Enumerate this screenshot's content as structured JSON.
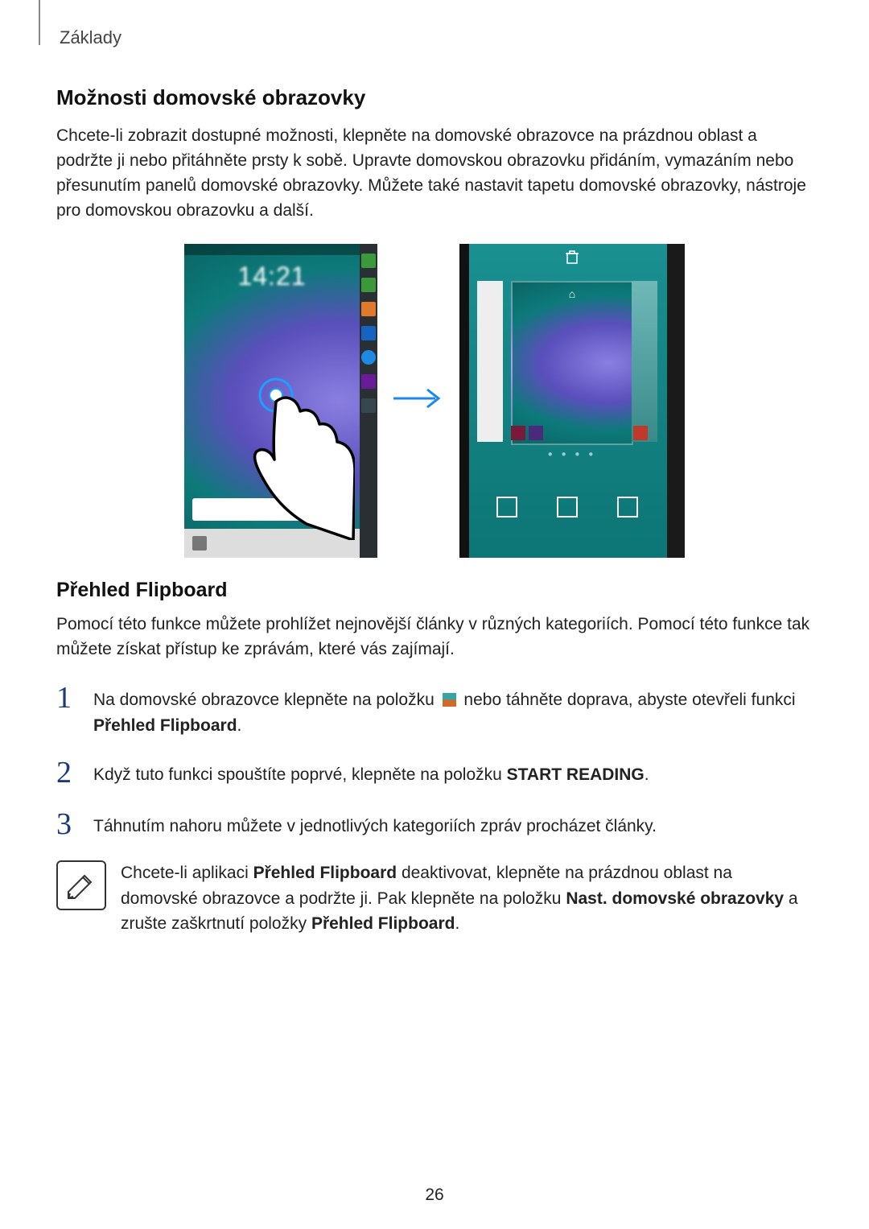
{
  "header": {
    "breadcrumb": "Základy"
  },
  "section1": {
    "title": "Možnosti domovské obrazovky",
    "body": "Chcete-li zobrazit dostupné možnosti, klepněte na domovské obrazovce na prázdnou oblast a podržte ji nebo přitáhněte prsty k sobě. Upravte domovskou obrazovku přidáním, vymazáním nebo přesunutím panelů domovské obrazovky. Můžete také nastavit tapetu domovské obrazovky, nástroje pro domovskou obrazovku a další."
  },
  "figure": {
    "clock": "14:21",
    "arrow_alt": "arrow-right"
  },
  "section2": {
    "title": "Přehled Flipboard",
    "intro": "Pomocí této funkce můžete prohlížet nejnovější články v různých kategoriích. Pomocí této funkce tak můžete získat přístup ke zprávám, které vás zajímají.",
    "steps": [
      {
        "num": "1",
        "pre": "Na domovské obrazovce klepněte na položku ",
        "post": " nebo táhněte doprava, abyste otevřeli funkci ",
        "bold_end": "Přehled Flipboard",
        "suffix": "."
      },
      {
        "num": "2",
        "pre": "Když tuto funkci spouštíte poprvé, klepněte na položku ",
        "bold_end": "START READING",
        "suffix": "."
      },
      {
        "num": "3",
        "text": "Táhnutím nahoru můžete v jednotlivých kategoriích zpráv procházet články."
      }
    ],
    "note": {
      "pre": "Chcete-li aplikaci ",
      "b1": "Přehled Flipboard",
      "mid1": " deaktivovat, klepněte na prázdnou oblast na domovské obrazovce a podržte ji. Pak klepněte na položku ",
      "b2": "Nast. domovské obrazovky",
      "mid2": " a zrušte zaškrtnutí položky ",
      "b3": "Přehled Flipboard",
      "suffix": "."
    }
  },
  "page_number": "26"
}
